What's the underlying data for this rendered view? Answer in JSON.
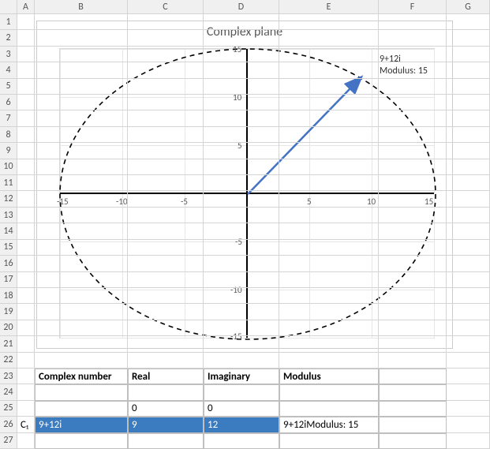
{
  "columns": [
    "A",
    "B",
    "C",
    "D",
    "E",
    "F",
    "G"
  ],
  "rows": [
    "1",
    "2",
    "3",
    "4",
    "5",
    "6",
    "7",
    "8",
    "9",
    "10",
    "11",
    "12",
    "13",
    "14",
    "15",
    "16",
    "17",
    "18",
    "19",
    "20",
    "21",
    "22",
    "23",
    "24",
    "25",
    "26",
    "27"
  ],
  "chart": {
    "title": "Complex plane",
    "annotation_line1": "9+12i",
    "annotation_line2": "Modulus: 15"
  },
  "chart_data": {
    "type": "scatter",
    "title": "Complex plane",
    "xlabel": "",
    "ylabel": "",
    "xlim": [
      -15,
      15
    ],
    "ylim": [
      -15,
      15
    ],
    "x_ticks": [
      -15,
      -10,
      -5,
      0,
      5,
      10,
      15
    ],
    "y_ticks": [
      -15,
      -10,
      -5,
      0,
      5,
      10,
      15
    ],
    "series": [
      {
        "name": "vector",
        "type": "line_arrow",
        "x": [
          0,
          9
        ],
        "y": [
          0,
          12
        ]
      },
      {
        "name": "modulus_circle",
        "type": "circle_dashed",
        "cx": 0,
        "cy": 0,
        "r": 15
      }
    ],
    "annotations": [
      {
        "text": "9+12i",
        "x": 11,
        "y": 14
      },
      {
        "text": "Modulus: 15",
        "x": 11,
        "y": 12.5
      }
    ]
  },
  "table": {
    "row_label": "C₁",
    "headers": {
      "b": "Complex number",
      "c": "Real",
      "d": "Imaginary",
      "e": "Modulus"
    },
    "r25": {
      "c": "0",
      "d": "0"
    },
    "r26": {
      "b": "9+12i",
      "c": "9",
      "d": "12",
      "e": "9+12iModulus: 15"
    }
  }
}
